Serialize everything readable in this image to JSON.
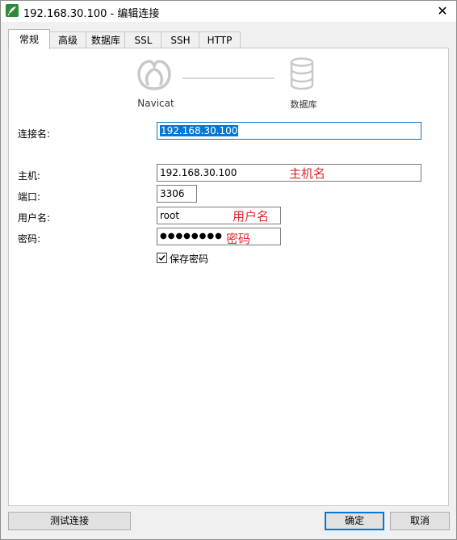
{
  "window": {
    "title": "192.168.30.100 - 编辑连接",
    "close_glyph": "✕"
  },
  "tabs": [
    {
      "label": "常规",
      "active": true
    },
    {
      "label": "高级",
      "active": false
    },
    {
      "label": "数据库",
      "active": false
    },
    {
      "label": "SSL",
      "active": false
    },
    {
      "label": "SSH",
      "active": false
    },
    {
      "label": "HTTP",
      "active": false
    }
  ],
  "diagram": {
    "left_label": "Navicat",
    "right_label": "数据库",
    "left_icon": "navicat-logo-icon",
    "right_icon": "database-icon"
  },
  "form": {
    "connection_name": {
      "label": "连接名:",
      "value": "192.168.30.100"
    },
    "host": {
      "label": "主机:",
      "value": "192.168.30.100",
      "annotation": "主机名"
    },
    "port": {
      "label": "端口:",
      "value": "3306"
    },
    "username": {
      "label": "用户名:",
      "value": "root",
      "annotation": "用户名"
    },
    "password": {
      "label": "密码:",
      "value": "●●●●●●●●",
      "annotation": "密码"
    },
    "save_password": {
      "label": "保存密码",
      "checked": true
    }
  },
  "buttons": {
    "test": "测试连接",
    "ok": "确定",
    "cancel": "取消"
  },
  "colors": {
    "accent": "#0078d7",
    "annotation": "#e0282e"
  }
}
